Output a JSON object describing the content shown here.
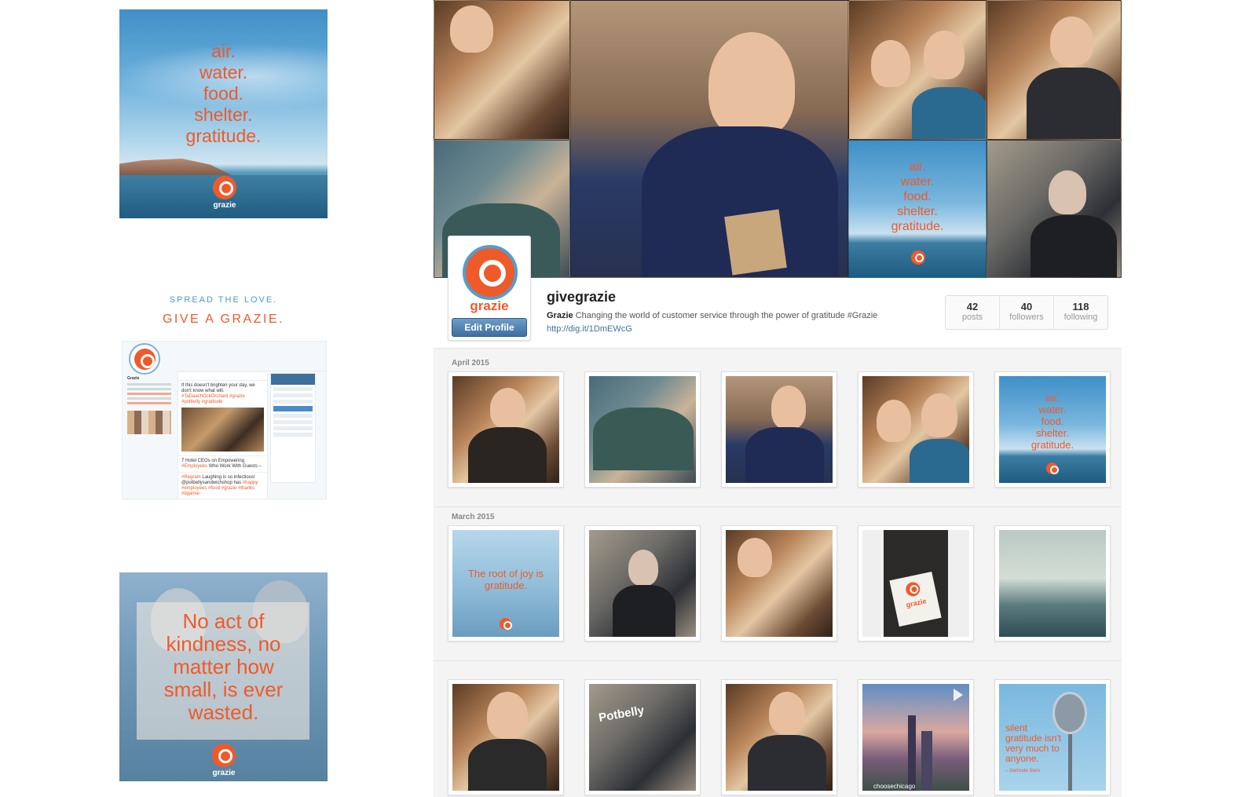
{
  "left_column": {
    "poster_air": {
      "lines": [
        "air.",
        "water.",
        "food.",
        "shelter.",
        "gratitude."
      ],
      "logo_word": "grazie"
    },
    "tagline_top": "SPREAD THE LOVE.",
    "tagline_bottom": "GIVE A GRAZIE.",
    "twitter_preview": {
      "profile_name": "Grazie",
      "tweet1_text": "If this doesn't brighten your day, we don't know what will.",
      "tweet1_tags": "#TaDaachOckOrchard #grazie #potbelly #gratitude",
      "tweet2_text": "7 Hotel CEOs on Empowering",
      "tweet2_tags": "#Employees",
      "tweet2_more": "Who Work With Guests –",
      "tweet3_tag1": "#Regram",
      "tweet3_text": "Laughing is so infectious! @potbellysandwichshop has",
      "tweet3_tags": "#happy #employees #food #grazie #thanks #bgamie"
    },
    "poster_kindness": {
      "text": "No act of kindness, no matter how small, is ever wasted.",
      "logo_word": "grazie"
    }
  },
  "instagram": {
    "banner_poster_lines": [
      "air.",
      "water.",
      "food.",
      "shelter.",
      "gratitude."
    ],
    "username": "givegrazie",
    "display_name": "Grazie",
    "bio": "Changing the world of customer service through the power of gratitude #Grazie",
    "link": "http://dig.it/1DmEWcG",
    "edit_profile_label": "Edit Profile",
    "avatar_word": "grazie",
    "stats": [
      {
        "value": "42",
        "label": "posts"
      },
      {
        "value": "40",
        "label": "followers"
      },
      {
        "value": "118",
        "label": "following"
      }
    ],
    "sections": [
      {
        "month": "April 2015"
      },
      {
        "month": "March 2015"
      }
    ],
    "grid_texts": {
      "air_poster": [
        "air.",
        "water.",
        "food.",
        "shelter.",
        "gratitude."
      ],
      "joy_poster": "The root of joy is gratitude.",
      "mic_poster": "silent gratitude isn't very much to anyone.",
      "mic_attrib": "– Gertrude Stein",
      "storefront_sign": "Potbelly",
      "city_handle": "choosechicago",
      "card_word": "grazie"
    }
  }
}
